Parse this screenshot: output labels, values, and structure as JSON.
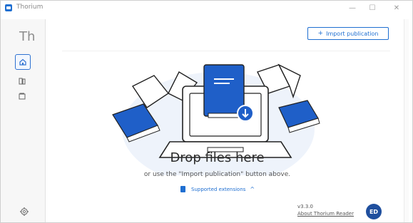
{
  "window": {
    "title": "Thorium",
    "controls": {
      "minimize": "—",
      "maximize": "☐",
      "close": "✕"
    }
  },
  "sidebar": {
    "brand": "Th",
    "items": [
      {
        "name": "home",
        "icon": "home-icon",
        "active": true
      },
      {
        "name": "library",
        "icon": "library-icon",
        "active": false
      },
      {
        "name": "catalogs",
        "icon": "catalog-icon",
        "active": false
      }
    ],
    "settings_icon": "gear-icon"
  },
  "header": {
    "import_button": {
      "icon": "+",
      "label": "Import publication"
    }
  },
  "dropzone": {
    "title": "Drop files here",
    "subtitle": "or use the \"Import publication\" button above.",
    "extensions_label": "Supported extensions",
    "extensions_chevron": "^"
  },
  "footer": {
    "version": "v3.3.0",
    "about": "About Thorium Reader",
    "badge_text": "ED"
  },
  "colors": {
    "accent": "#1f6fd1",
    "badge": "#1f4f9e",
    "illustration_bg": "#eef3fb"
  }
}
